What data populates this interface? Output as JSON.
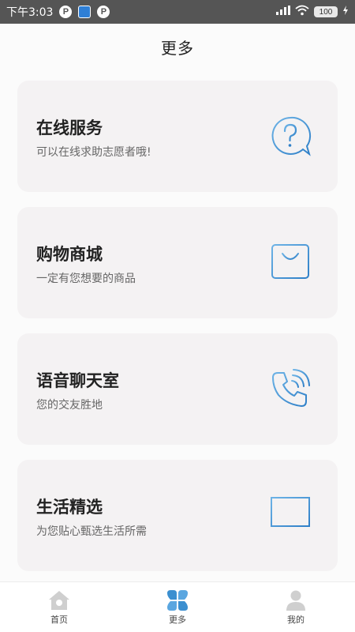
{
  "status_bar": {
    "time": "下午3:03",
    "badge_p": "P",
    "signal": "signal-icon",
    "wifi": "wifi-icon",
    "battery": "100"
  },
  "header": {
    "title": "更多"
  },
  "cards": [
    {
      "title": "在线服务",
      "subtitle": "可以在线求助志愿者哦!",
      "icon": "question-bubble-icon"
    },
    {
      "title": "购物商城",
      "subtitle": "一定有您想要的商品",
      "icon": "shopping-bag-icon"
    },
    {
      "title": "语音聊天室",
      "subtitle": "您的交友胜地",
      "icon": "phone-icon"
    },
    {
      "title": "生活精选",
      "subtitle": "为您贴心甄选生活所需",
      "icon": "chart-board-icon"
    }
  ],
  "tabbar": {
    "items": [
      {
        "label": "首页",
        "icon": "home-icon"
      },
      {
        "label": "更多",
        "icon": "clover-icon",
        "active": true
      },
      {
        "label": "我的",
        "icon": "user-icon"
      }
    ]
  },
  "colors": {
    "accent": "#3b8fd0",
    "card_bg": "#f4f2f3",
    "status_bar": "#555555"
  }
}
